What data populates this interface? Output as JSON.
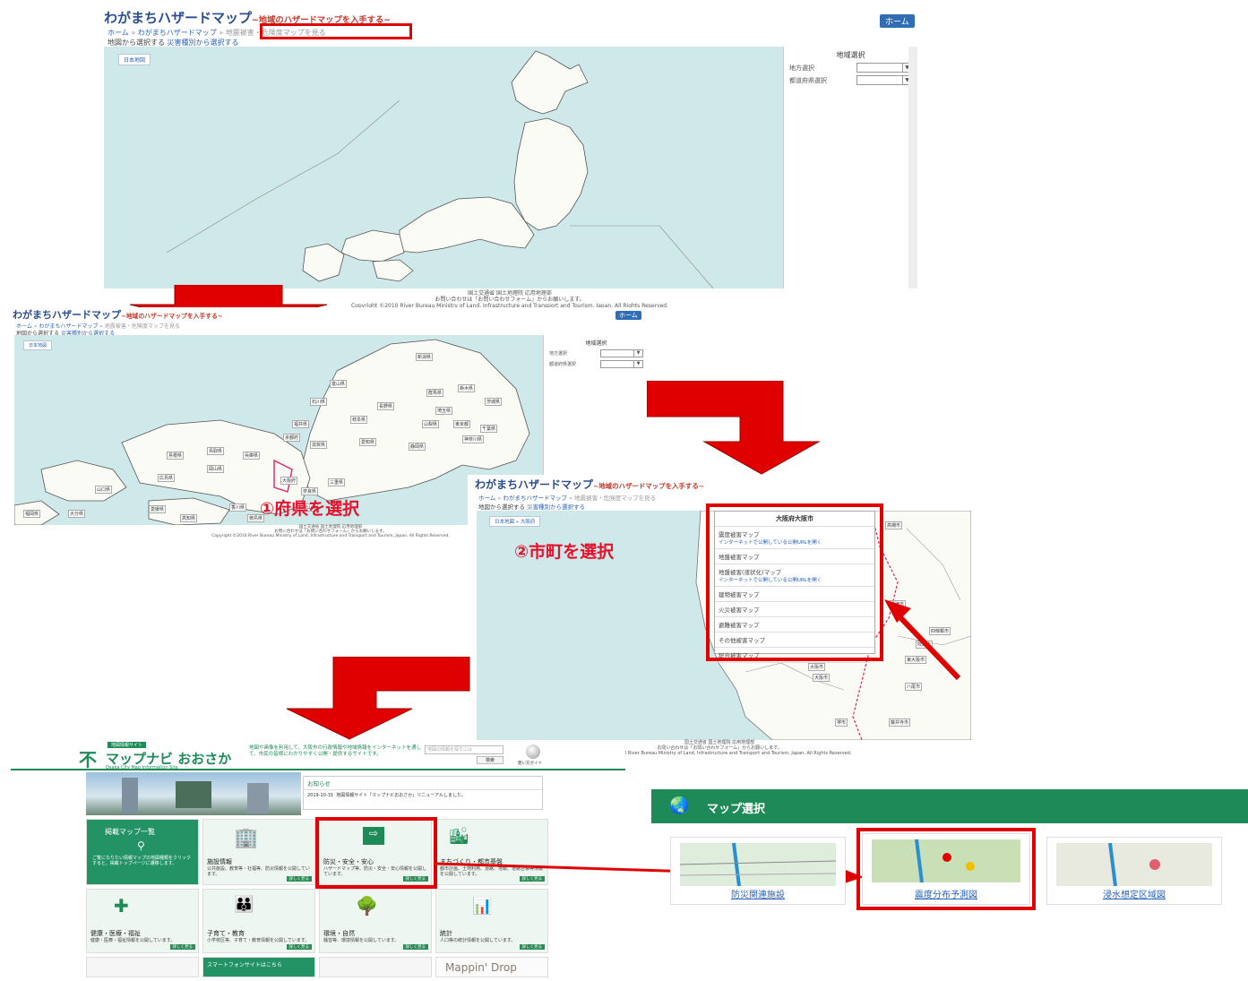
{
  "screen1": {
    "title": "わがまちハザードマップ",
    "subtitle": "~地域のハザードマップを入手する~",
    "home_button": "ホーム",
    "breadcrumb": {
      "home": "ホーム",
      "sep": "»",
      "site": "わがまちハザードマップ",
      "current": "地震被害・危険度マップを見る"
    },
    "tabs": {
      "from_map": "地図から選択する",
      "by_type": "災害種別から選択する"
    },
    "map_button": "日本地図",
    "side": {
      "title": "地域選択",
      "region_label": "地方選択",
      "pref_label": "都道府県選択"
    },
    "footer": [
      "国土交通省 国土地理院 応用地理部",
      "お問い合わせは「お問い合わせフォーム」からお願いします。",
      "Copyright ©2010 River Bureau Ministry of Land, Infrastructure and Transport and Tourism, Japan. All Rights Reserved."
    ]
  },
  "screen2": {
    "title": "わがまちハザードマップ",
    "subtitle": "~地域のハザードマップを入手する~",
    "home_button": "ホーム",
    "breadcrumb": {
      "home": "ホーム",
      "sep": "»",
      "site": "わがまちハザードマップ",
      "current": "地震被害・危険度マップを見る"
    },
    "tabs": {
      "from_map": "地図から選択する",
      "by_type": "災害種別から選択する"
    },
    "map_button": "日本地図",
    "side": {
      "title": "地域選択",
      "region_label": "地方選択",
      "pref_label": "都道府県選択"
    },
    "prefectures": [
      "新潟県",
      "富山県",
      "石川県",
      "福井県",
      "長野県",
      "群馬県",
      "栃木県",
      "茨城県",
      "埼玉県",
      "東京都",
      "千葉県",
      "神奈川県",
      "山梨県",
      "静岡県",
      "愛知県",
      "岐阜県",
      "滋賀県",
      "京都府",
      "大阪府",
      "兵庫県",
      "奈良県",
      "三重県",
      "和歌山県",
      "鳥取県",
      "岡山県",
      "広島県",
      "島根県",
      "山口県",
      "香川県",
      "徳島県",
      "愛媛県",
      "高知県",
      "福岡県",
      "大分県"
    ],
    "footer": [
      "国土交通省 国土地理院 応用地理部",
      "お問い合わせは「お問い合わせフォーム」からお願いします。",
      "Copyright ©2010 River Bureau Ministry of Land, Infrastructure and Transport and Tourism, Japan. All Rights Reserved."
    ]
  },
  "step1_label": "①府県を選択",
  "screen3": {
    "title": "わがまちハザードマップ",
    "subtitle": "~地域のハザードマップを入手する~",
    "breadcrumb": {
      "home": "ホーム",
      "sep": "»",
      "site": "わがまちハザードマップ",
      "current": "地震被害・危険度マップを見る"
    },
    "tabs": {
      "from_map": "地図から選択する",
      "by_type": "災害種別から選択する"
    },
    "map_path": "日本地図 » 大阪府",
    "popup_title": "大阪府大阪市",
    "menu": [
      {
        "label": "震度被害マップ",
        "link": "インターネットで公開している公開URLを開く"
      },
      {
        "label": "地盤被害マップ",
        "link": ""
      },
      {
        "label": "地盤被害(液状化)マップ",
        "link": "インターネットで公開している公開URLを開く"
      },
      {
        "label": "建物被害マップ",
        "link": ""
      },
      {
        "label": "火災被害マップ",
        "link": ""
      },
      {
        "label": "避難被害マップ",
        "link": ""
      },
      {
        "label": "その他被害マップ",
        "link": ""
      },
      {
        "label": "総合被害マップ",
        "link": ""
      }
    ],
    "city_labels": [
      "高槻市",
      "大阪市",
      "大阪市",
      "東大阪市",
      "八尾市",
      "堺市",
      "藤井寺市",
      "摂津市",
      "四條畷市",
      "吹田市"
    ],
    "footer": [
      "国土交通省 国土地理院 応用地理部",
      "お問い合わせは「お問い合わせフォーム」からお願いします。",
      "Copyright ©2010 River Bureau Ministry of Land, Infrastructure and Transport and Tourism, Japan. All Rights Reserved."
    ]
  },
  "step2_label": "②市町を選択",
  "screen4": {
    "badge": "地図情報サイト",
    "logo_text": "マップナビ おおさか",
    "logo_en": "Osaka City Map Information Site",
    "intro": "地図や画像を利用して、大阪市の行政情報や地域情報をインターネットを通して、市民の皆様にわかりやすく公開・提供するサイトです。",
    "search_placeholder": "地図の情報を探すには",
    "search_button": "検索",
    "help_label": "使い方ガイド",
    "news_title": "お知らせ",
    "news_date": "2019-10-31",
    "news_text": "地図情報サイト「マップナビおおさか」リニューアルしました。",
    "tiles": [
      {
        "title": "掲載マップ一覧",
        "desc": "ご覧になりたい情報マップの地図種類をクリックすると、掲載トップページに遷移します。",
        "more": ""
      },
      {
        "title": "施設情報",
        "desc": "公共施設、教育等・社福等、防災情報を公開しています。",
        "more": "詳しく見る"
      },
      {
        "title": "防災・安全・安心",
        "desc": "ハザードマップ等、防災・安全・安心情報を公開しています。",
        "more": "詳しく見る"
      },
      {
        "title": "まちづくり・都市基盤",
        "desc": "都市計画、土地利用、道路、地籍、道路台帳等情報を公開しています。",
        "more": "詳しく見る"
      },
      {
        "title": "健康・医療・福祉",
        "desc": "健康・医療・福祉情報を公開しています。",
        "more": "詳しく見る"
      },
      {
        "title": "子育て・教育",
        "desc": "小学校区等、子育て・教育情報を公開しています。",
        "more": "詳しく見る"
      },
      {
        "title": "環境・自然",
        "desc": "騒音等、環境情報を公開しています。",
        "more": "詳しく見る"
      },
      {
        "title": "統計",
        "desc": "人口等の統計情報を公開しています。",
        "more": "詳しく見る"
      }
    ],
    "bottom_tiles": [
      "",
      "スマートフォンサイトはこちら",
      "",
      "Mappin' Drop"
    ]
  },
  "screen5": {
    "header": "マップ選択",
    "thumbs": [
      "防災関連施設",
      "震度分布予測図",
      "浸水想定区域図"
    ]
  },
  "colors": {
    "accent_red": "#e00000",
    "site_blue": "#2a4d8f",
    "green": "#1e8a58",
    "map_sea": "#cfe8ea"
  }
}
